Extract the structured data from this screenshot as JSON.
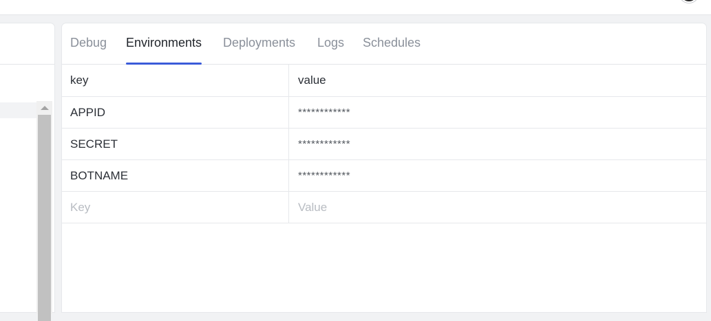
{
  "tabs": [
    {
      "label": "Debug",
      "active": false
    },
    {
      "label": "Environments",
      "active": true
    },
    {
      "label": "Deployments",
      "active": false
    },
    {
      "label": "Logs",
      "active": false
    },
    {
      "label": "Schedules",
      "active": false
    }
  ],
  "table": {
    "headers": {
      "key": "key",
      "value": "value"
    },
    "rows": [
      {
        "key": "APPID",
        "value": "************"
      },
      {
        "key": "SECRET",
        "value": "************"
      },
      {
        "key": "BOTNAME",
        "value": "************"
      }
    ],
    "new_row": {
      "key_placeholder": "Key",
      "value_placeholder": "Value"
    }
  },
  "colors": {
    "accent": "#3a5bd9",
    "active_tab_text": "#1f2329",
    "inactive_tab_text": "#8a909a",
    "placeholder": "#b8bcc2"
  }
}
